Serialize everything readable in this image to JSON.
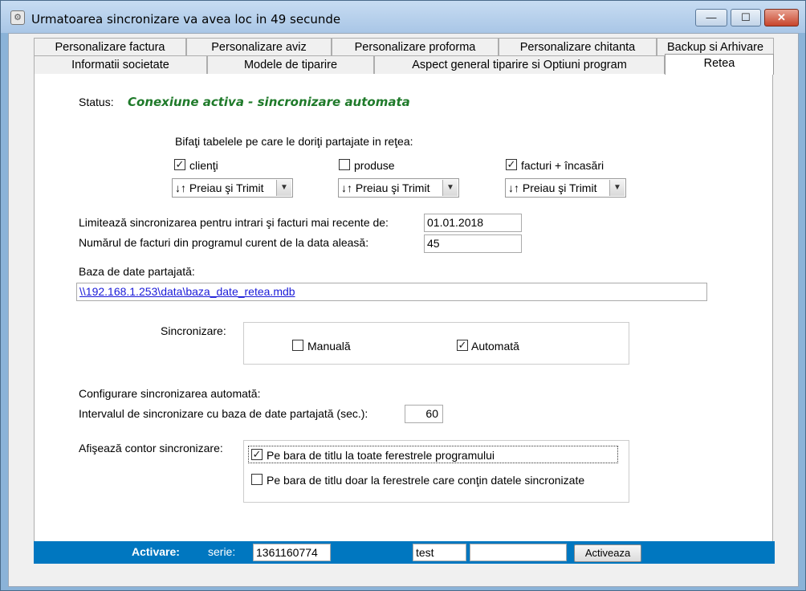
{
  "window": {
    "title": "Urmatoarea sincronizare va avea loc in 49 secunde",
    "minimize": "—",
    "maximize": "☐",
    "close": "✕"
  },
  "tabs_row1": [
    "Personalizare factura",
    "Personalizare aviz",
    "Personalizare proforma",
    "Personalizare chitanta",
    "Backup si Arhivare"
  ],
  "tabs_row2": [
    "Informatii societate",
    "Modele de tiparire",
    "Aspect general tiparire si Optiuni program",
    "Retea"
  ],
  "selected_tab": "Retea",
  "status": {
    "label": "Status:",
    "value": "Conexiune activa - sincronizare automata",
    "color": "#1f7a2a"
  },
  "tables": {
    "heading": "Bifaţi tabelele pe care le doriţi partajate in reţea:",
    "items": [
      {
        "label": "clienţi",
        "checked": true,
        "mode": "↓↑ Preiau şi Trimit"
      },
      {
        "label": "produse",
        "checked": false,
        "mode": "↓↑ Preiau şi Trimit"
      },
      {
        "label": "facturi + încasări",
        "checked": true,
        "mode": "↓↑ Preiau şi Trimit"
      }
    ]
  },
  "limit": {
    "label": "Limitează sincronizarea pentru intrari şi facturi mai recente de:",
    "value": "01.01.2018"
  },
  "invoice_count": {
    "label": "Numărul de facturi din programul curent de la data aleasă:",
    "value": "45"
  },
  "database": {
    "label": "Baza de date partajată:",
    "path": "\\\\192.168.1.253\\data\\baza_date_retea.mdb"
  },
  "sync": {
    "label": "Sincronizare:",
    "manual": {
      "label": "Manuală",
      "checked": false
    },
    "auto": {
      "label": "Automată",
      "checked": true
    }
  },
  "auto_config": {
    "heading": "Configurare sincronizarea automată:",
    "interval_label": "Intervalul de sincronizare cu baza de date partajată (sec.):",
    "interval_value": "60"
  },
  "counter": {
    "label": "Afişează contor sincronizare:",
    "opt1": {
      "label": "Pe bara de titlu la toate ferestrele programului",
      "checked": true
    },
    "opt2": {
      "label": "Pe bara de titlu doar la ferestrele care conţin datele sincronizate",
      "checked": false
    }
  },
  "activation": {
    "label": "Activare:",
    "serie_label": "serie:",
    "serie_value": "1361160774",
    "name_value": "test",
    "code_value": "",
    "button": "Activeaza",
    "bar_color": "#0077c0"
  }
}
